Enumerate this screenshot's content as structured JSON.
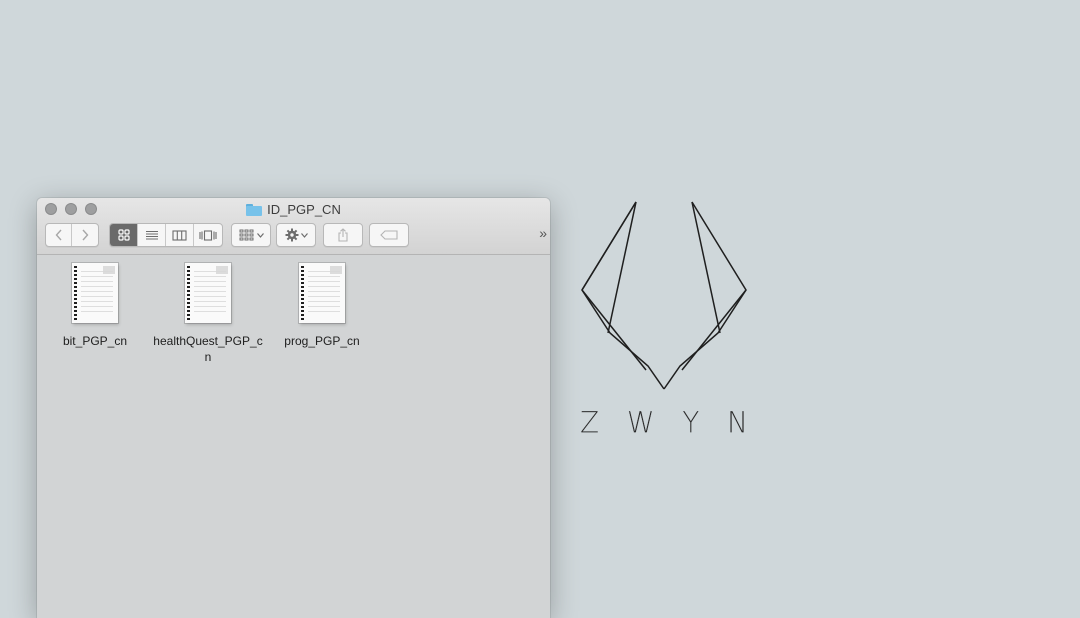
{
  "window": {
    "title": "ID_PGP_CN",
    "traffic_lights": [
      "close",
      "minimize",
      "zoom"
    ]
  },
  "toolbar": {
    "back_icon": "chevron-left-icon",
    "forward_icon": "chevron-right-icon",
    "views": [
      {
        "name": "icon-view-icon",
        "active": true
      },
      {
        "name": "list-view-icon",
        "active": false
      },
      {
        "name": "column-view-icon",
        "active": false
      },
      {
        "name": "cover-flow-icon",
        "active": false
      }
    ],
    "arrange_icon": "arrange-grid-icon",
    "action_icon": "gear-icon",
    "share_icon": "share-icon",
    "tag_icon": "tag-icon",
    "more_label": "»"
  },
  "files": [
    {
      "name": "bit_PGP_cn"
    },
    {
      "name": "healthQuest_PGP_cn"
    },
    {
      "name": "prog_PGP_cn"
    }
  ],
  "brand": {
    "letters": [
      "Z",
      "W",
      "Y",
      "N"
    ]
  }
}
